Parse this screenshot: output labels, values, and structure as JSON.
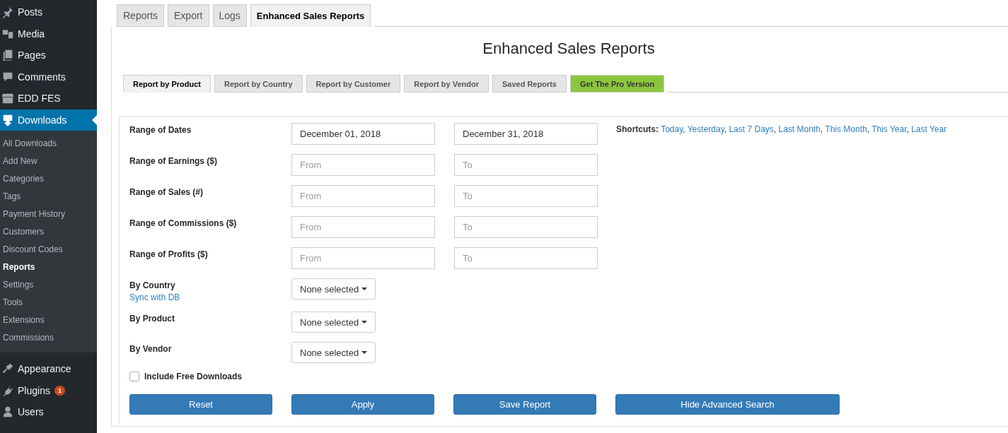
{
  "sidebar": {
    "items": [
      {
        "label": "Posts",
        "selected": false
      },
      {
        "label": "Media",
        "selected": false
      },
      {
        "label": "Pages",
        "selected": false
      },
      {
        "label": "Comments",
        "selected": false
      },
      {
        "label": "EDD FES",
        "selected": false
      },
      {
        "label": "Downloads",
        "selected": true,
        "children": [
          {
            "label": "All Downloads",
            "selected": false
          },
          {
            "label": "Add New",
            "selected": false
          },
          {
            "label": "Categories",
            "selected": false
          },
          {
            "label": "Tags",
            "selected": false
          },
          {
            "label": "Payment History",
            "selected": false
          },
          {
            "label": "Customers",
            "selected": false
          },
          {
            "label": "Discount Codes",
            "selected": false
          },
          {
            "label": "Reports",
            "selected": true
          },
          {
            "label": "Settings",
            "selected": false
          },
          {
            "label": "Tools",
            "selected": false
          },
          {
            "label": "Extensions",
            "selected": false
          },
          {
            "label": "Commissions",
            "selected": false
          }
        ]
      },
      {
        "label": "Appearance",
        "selected": false
      },
      {
        "label": "Plugins",
        "selected": false,
        "badge": "1"
      },
      {
        "label": "Users",
        "selected": false
      }
    ]
  },
  "top_tabs": [
    {
      "label": "Reports",
      "selected": false
    },
    {
      "label": "Export",
      "selected": false
    },
    {
      "label": "Logs",
      "selected": false
    },
    {
      "label": "Enhanced Sales Reports",
      "selected": true
    }
  ],
  "title": "Enhanced Sales Reports",
  "report_tabs": [
    {
      "label": "Report by Product",
      "selected": true,
      "kind": "tab"
    },
    {
      "label": "Report by Country",
      "selected": false,
      "kind": "tab"
    },
    {
      "label": "Report by Customer",
      "selected": false,
      "kind": "tab"
    },
    {
      "label": "Report by Vendor",
      "selected": false,
      "kind": "tab"
    },
    {
      "label": "Saved Reports",
      "selected": false,
      "kind": "tab"
    },
    {
      "label": "Get The Pro Version",
      "selected": false,
      "kind": "promo"
    }
  ],
  "form": {
    "rows": [
      {
        "kind": "range",
        "label": "Range of Dates",
        "from": {
          "value": "December 01, 2018"
        },
        "to": {
          "value": "December 31, 2018"
        }
      },
      {
        "kind": "range",
        "label": "Range of Earnings ($)",
        "from": {
          "placeholder": "From"
        },
        "to": {
          "placeholder": "To"
        }
      },
      {
        "kind": "range",
        "label": "Range of Sales (#)",
        "from": {
          "placeholder": "From"
        },
        "to": {
          "placeholder": "To"
        }
      },
      {
        "kind": "range",
        "label": "Range of Commissions ($)",
        "from": {
          "placeholder": "From"
        },
        "to": {
          "placeholder": "To"
        }
      },
      {
        "kind": "range",
        "label": "Range of Profits ($)",
        "from": {
          "placeholder": "From"
        },
        "to": {
          "placeholder": "To"
        }
      },
      {
        "kind": "select",
        "label": "By Country",
        "link": "Sync with DB",
        "value": "None selected"
      },
      {
        "kind": "select",
        "label": "By Product",
        "value": "None selected"
      },
      {
        "kind": "select",
        "label": "By Vendor",
        "value": "None selected"
      }
    ],
    "shortcuts": {
      "label": "Shortcuts:",
      "separator": ",",
      "links": [
        "Today",
        "Yesterday",
        "Last 7 Days",
        "Last Month",
        "This Month",
        "This Year",
        "Last Year"
      ]
    },
    "include_free": {
      "label": "Include Free Downloads",
      "checked": false
    },
    "buttons": [
      "Reset",
      "Apply",
      "Save Report",
      "Hide Advanced Search"
    ]
  }
}
